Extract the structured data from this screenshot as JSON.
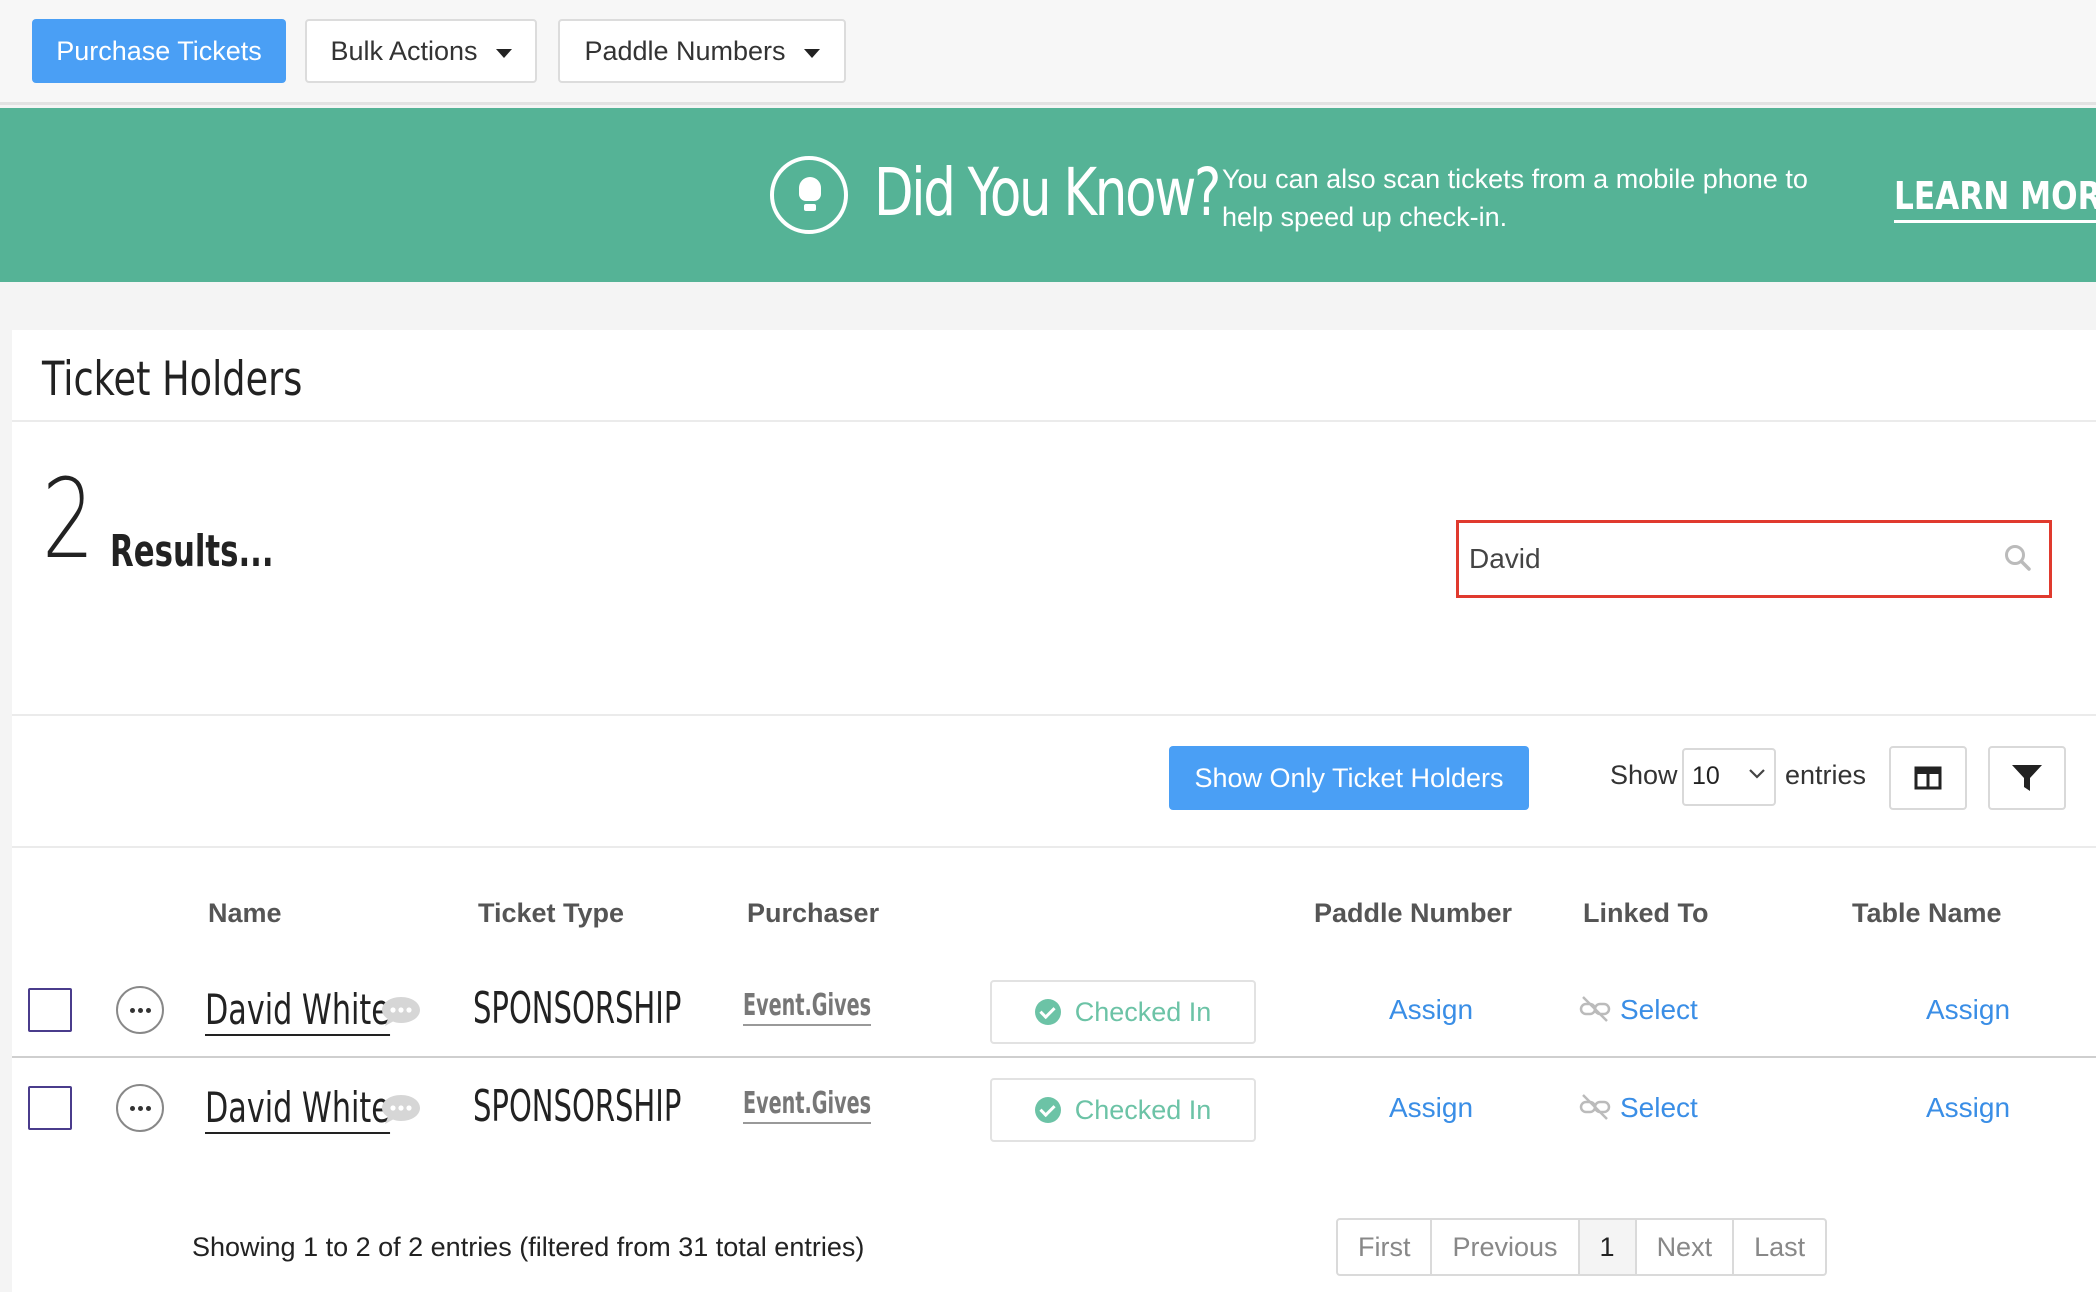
{
  "toolbar": {
    "purchase_label": "Purchase Tickets",
    "bulk_actions_label": "Bulk Actions",
    "paddle_numbers_label": "Paddle Numbers"
  },
  "banner": {
    "title": "Did You Know?",
    "text": "You can also scan tickets from a mobile phone to help speed up check-in.",
    "cta": "LEARN MORE",
    "icon": "lightbulb-icon",
    "color": "#55b396"
  },
  "panel": {
    "title": "Ticket Holders",
    "results_count": "2",
    "results_label": "Results...",
    "search": {
      "value": "David",
      "icon": "search-icon"
    }
  },
  "controls": {
    "show_only_label": "Show Only Ticket Holders",
    "show_label": "Show",
    "entries_value": "10",
    "entries_label": "entries",
    "columns_icon": "columns-icon",
    "filter_icon": "filter-icon"
  },
  "table": {
    "headers": [
      "Name",
      "Ticket Type",
      "Purchaser",
      "Paddle Number",
      "Linked To",
      "Table Name"
    ],
    "rows": [
      {
        "name": "David White",
        "ticket_type": "SPONSORSHIP",
        "purchaser": "Event.Gives",
        "status": "Checked In",
        "paddle": "Assign",
        "linked": "Select",
        "table": "Assign"
      },
      {
        "name": "David White",
        "ticket_type": "SPONSORSHIP",
        "purchaser": "Event.Gives",
        "status": "Checked In",
        "paddle": "Assign",
        "linked": "Select",
        "table": "Assign"
      }
    ]
  },
  "footer": {
    "info": "Showing 1 to 2 of 2 entries (filtered from 31 total entries)",
    "pagination": [
      "First",
      "Previous",
      "1",
      "Next",
      "Last"
    ]
  },
  "colors": {
    "primary": "#4a9ff5",
    "link": "#3a8ee6",
    "success": "#6cc3a6",
    "highlight": "#e03a2e"
  }
}
